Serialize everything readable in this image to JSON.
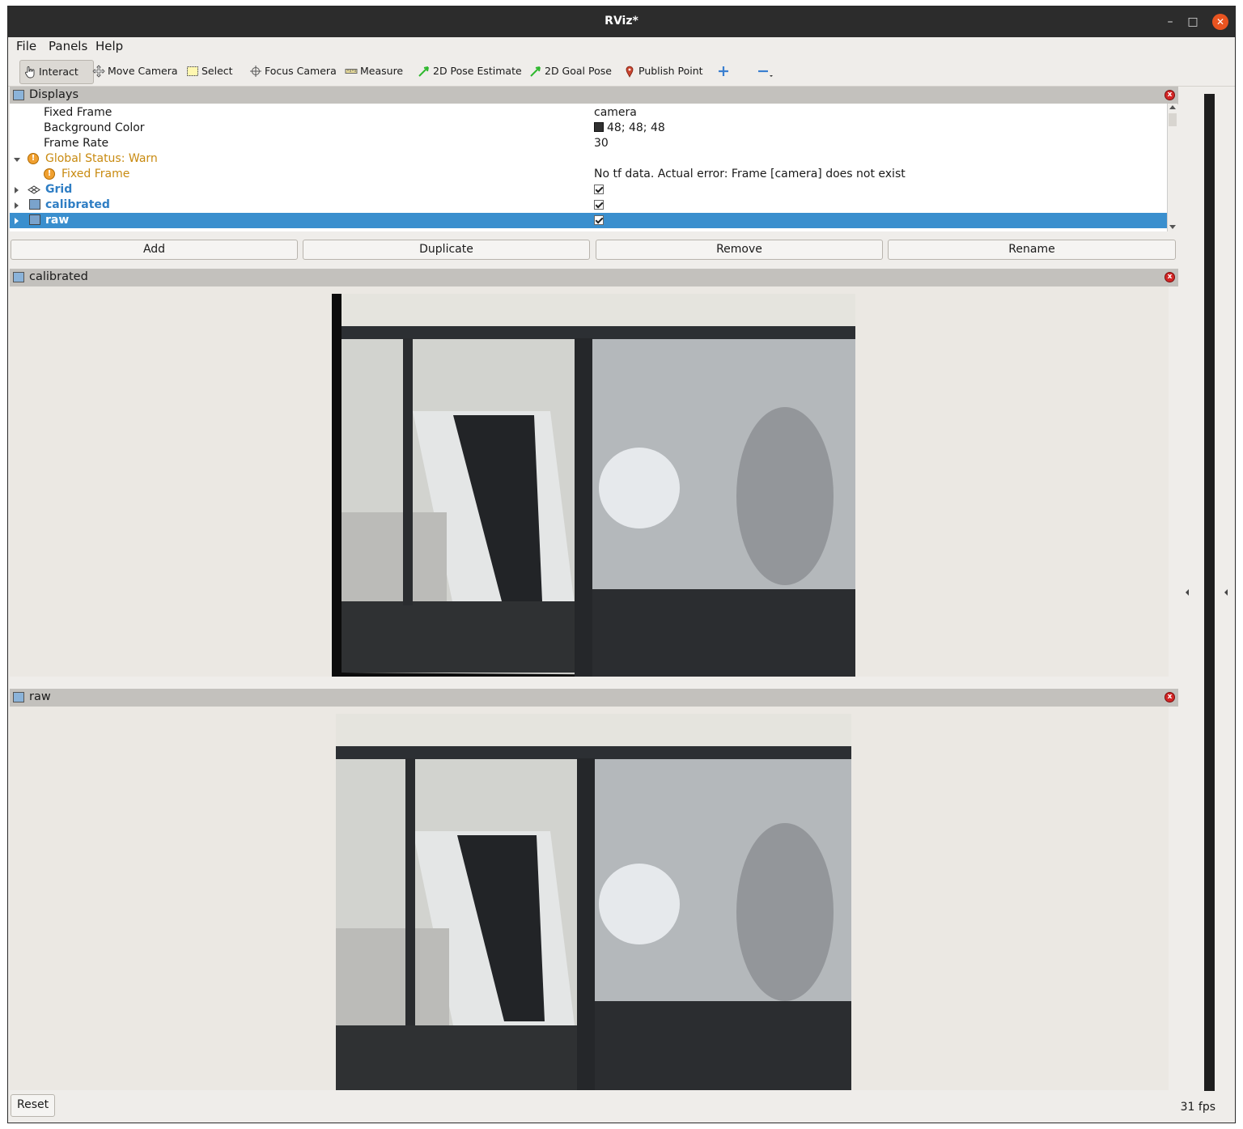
{
  "window": {
    "title": "RViz*"
  },
  "menu": [
    "File",
    "Panels",
    "Help"
  ],
  "toolbar": {
    "interact": "Interact",
    "move_camera": "Move Camera",
    "select": "Select",
    "focus_camera": "Focus Camera",
    "measure": "Measure",
    "pose_estimate": "2D Pose Estimate",
    "goal_pose": "2D Goal Pose",
    "publish_point": "Publish Point"
  },
  "displays": {
    "title": "Displays",
    "rows": [
      {
        "label": "Fixed Frame",
        "value": "camera"
      },
      {
        "label": "Background Color",
        "value": "48; 48; 48"
      },
      {
        "label": "Frame Rate",
        "value": "30"
      },
      {
        "label": "Global Status: Warn",
        "value": ""
      },
      {
        "label": "Fixed Frame",
        "value": "No tf data.  Actual error: Frame [camera] does not exist"
      },
      {
        "label": "Grid",
        "value": ""
      },
      {
        "label": "calibrated",
        "value": ""
      },
      {
        "label": "raw",
        "value": ""
      }
    ],
    "buttons": {
      "add": "Add",
      "duplicate": "Duplicate",
      "remove": "Remove",
      "rename": "Rename"
    }
  },
  "panels": {
    "calibrated": "calibrated",
    "raw": "raw"
  },
  "status": {
    "reset": "Reset",
    "fps": "31 fps"
  },
  "colors": {
    "selection": "#3a8fce",
    "warn": "#c88a10",
    "display_name": "#2f7ec4",
    "background_swatch": "#303030"
  }
}
